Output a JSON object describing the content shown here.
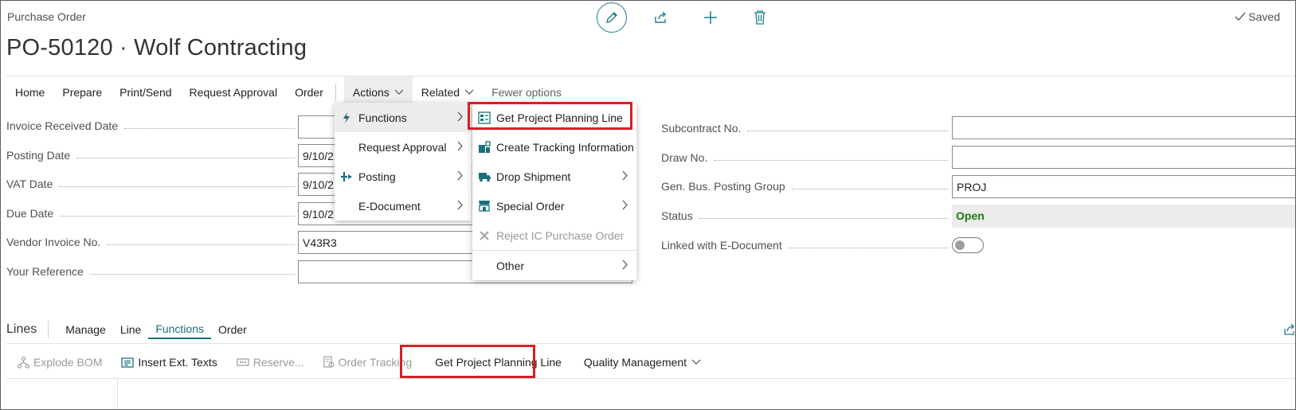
{
  "header": {
    "page_kind": "Purchase Order",
    "title": "PO-50120 · Wolf Contracting",
    "saved_label": "Saved"
  },
  "actionbar": {
    "items": [
      "Home",
      "Prepare",
      "Print/Send",
      "Request Approval",
      "Order"
    ],
    "actions_label": "Actions",
    "related_label": "Related",
    "fewer_label": "Fewer options"
  },
  "left_fields": [
    {
      "label": "Invoice Received Date",
      "value": ""
    },
    {
      "label": "Posting Date",
      "value": "9/10/2"
    },
    {
      "label": "VAT Date",
      "value": "9/10/2"
    },
    {
      "label": "Due Date",
      "value": "9/10/2"
    },
    {
      "label": "Vendor Invoice No.",
      "value": "V43R3"
    },
    {
      "label": "Your Reference",
      "value": ""
    }
  ],
  "right_fields": [
    {
      "label": "Subcontract No.",
      "value": ""
    },
    {
      "label": "Draw No.",
      "value": ""
    },
    {
      "label": "Gen. Bus. Posting Group",
      "value": "PROJ"
    },
    {
      "label": "Status",
      "value": "Open"
    },
    {
      "label": "Linked with E-Document",
      "value": "off"
    }
  ],
  "actions_menu": {
    "items": [
      "Functions",
      "Request Approval",
      "Posting",
      "E-Document"
    ]
  },
  "functions_menu": {
    "items": [
      "Get Project Planning Line",
      "Create Tracking Information",
      "Drop Shipment",
      "Special Order",
      "Reject IC Purchase Order",
      "Other"
    ]
  },
  "lines": {
    "title": "Lines",
    "tabs": [
      "Manage",
      "Line",
      "Functions",
      "Order"
    ],
    "actions": [
      "Explode BOM",
      "Insert Ext. Texts",
      "Reserve...",
      "Order Tracking",
      "Get Project Planning Line",
      "Quality Management"
    ]
  },
  "colors": {
    "accent": "#1b6f7c",
    "highlight": "#d51f26",
    "status_open": "#1a7a12"
  }
}
